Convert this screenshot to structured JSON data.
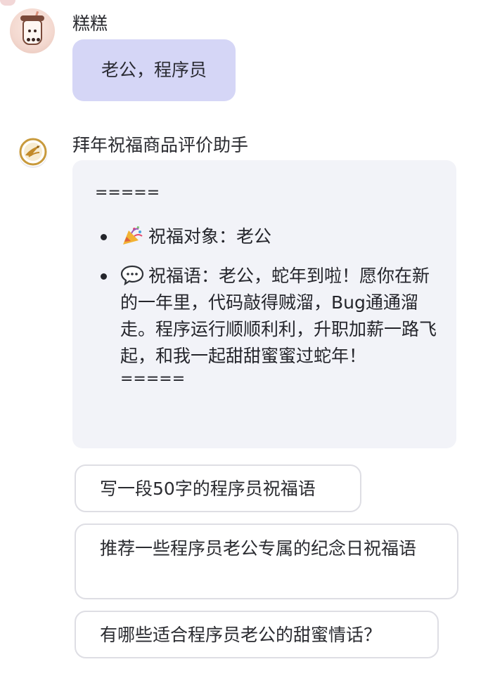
{
  "user": {
    "name": "糕糕",
    "message": "老公，程序员",
    "avatar_icon": "bubble-tea-avatar-icon"
  },
  "bot": {
    "name": "拜年祝福商品评价助手",
    "avatar_icon": "golden-crane-logo-icon",
    "separator_top": "=====",
    "separator_bottom": "=====",
    "items": [
      {
        "icon": "party-popper-icon",
        "text": "祝福对象：老公"
      },
      {
        "icon": "speech-bubble-icon",
        "text": "祝福语：老公，蛇年到啦！愿你在新的一年里，代码敲得贼溜，Bug通通溜走。程序运行顺顺利利，升职加薪一路飞起，和我一起甜甜蜜蜜过蛇年！"
      }
    ]
  },
  "suggestions": [
    "写一段50字的程序员祝福语",
    "推荐一些程序员老公专属的纪念日祝福语",
    "有哪些适合程序员老公的甜蜜情话？"
  ],
  "colors": {
    "user_bubble": "#d5d6f6",
    "bot_card": "#f2f3f8",
    "chip_border": "#dedee4"
  }
}
